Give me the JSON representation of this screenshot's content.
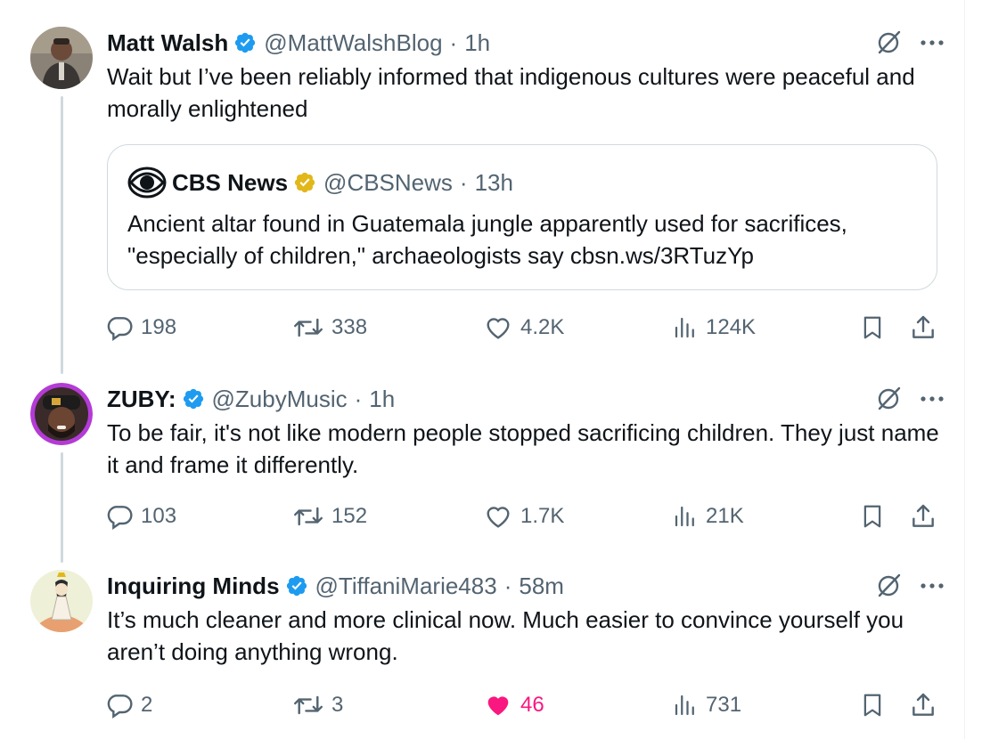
{
  "tweets": [
    {
      "name": "Matt Walsh",
      "handle": "@MattWalshBlog",
      "time": "1h",
      "text": "Wait but I’ve been reliably informed that indigenous cultures were peaceful and morally enlightened",
      "quote": {
        "name": "CBS News",
        "handle": "@CBSNews",
        "time": "13h",
        "text": "Ancient altar found in Guatemala jungle apparently used for sacrifices, \"especially of children,\" archaeologists say cbsn.ws/3RTuzYp"
      },
      "stats": {
        "replies": "198",
        "reposts": "338",
        "likes": "4.2K",
        "views": "124K"
      }
    },
    {
      "name": "ZUBY:",
      "handle": "@ZubyMusic",
      "time": "1h",
      "text": "To be fair, it's not like modern people stopped sacrificing children. They just name it and frame it differently.",
      "stats": {
        "replies": "103",
        "reposts": "152",
        "likes": "1.7K",
        "views": "21K"
      }
    },
    {
      "name": "Inquiring Minds",
      "handle": "@TiffaniMarie483",
      "time": "58m",
      "text": "It’s much cleaner and more clinical now. Much easier to convince yourself you aren’t doing anything wrong.",
      "stats": {
        "replies": "2",
        "reposts": "3",
        "likes": "46",
        "views": "731"
      },
      "liked": true
    }
  ],
  "separator": "·",
  "colors": {
    "blue_check": "#1d9bf0",
    "gold_check": "#e2b719",
    "like_pink": "#f91880",
    "muted_text": "#536471"
  },
  "icons": [
    "verified-badge-icon",
    "grok-icon",
    "more-icon",
    "reply-icon",
    "repost-icon",
    "like-icon",
    "views-icon",
    "bookmark-icon",
    "share-icon",
    "cbs-eye-icon"
  ]
}
